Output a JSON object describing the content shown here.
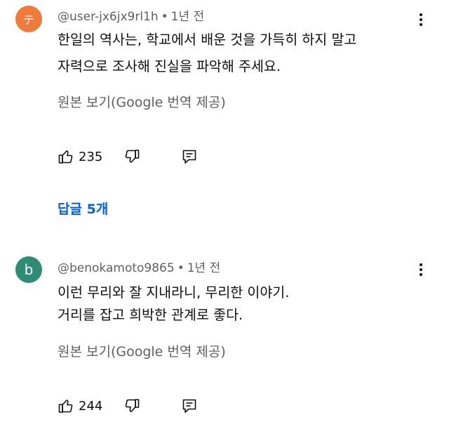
{
  "comments": [
    {
      "avatar_letter": "テ",
      "avatar_color": "#f07a3a",
      "handle": "@user-jx6jx9rl1h",
      "separator": "•",
      "time": "1년 전",
      "text_lines": [
        "한일의 역사는, 학교에서 배운 것을 가득히 하지 말고",
        "자력으로 조사해 진실을 파악해 주세요."
      ],
      "translate_label": "원본 보기(Google 번역 제공)",
      "likes": "235",
      "replies_label": "답글 5개",
      "icons": [
        "thumb-up-icon",
        "thumb-down-icon",
        "reply-icon",
        "more-vert-icon"
      ]
    },
    {
      "avatar_letter": "b",
      "avatar_color": "#2e8b74",
      "handle": "@benokamoto9865",
      "separator": "•",
      "time": "1년 전",
      "text_lines": [
        "이런 무리와 잘 지내라니, 무리한 이야기.",
        "거리를 잡고 희박한 관계로 좋다."
      ],
      "translate_label": "원본 보기(Google 번역 제공)",
      "likes": "244",
      "icons": [
        "thumb-up-icon",
        "thumb-down-icon",
        "reply-icon",
        "more-vert-icon"
      ]
    }
  ],
  "colors": {
    "meta_text": "#606060",
    "link_blue": "#065fd4",
    "text": "#0f0f0f"
  }
}
